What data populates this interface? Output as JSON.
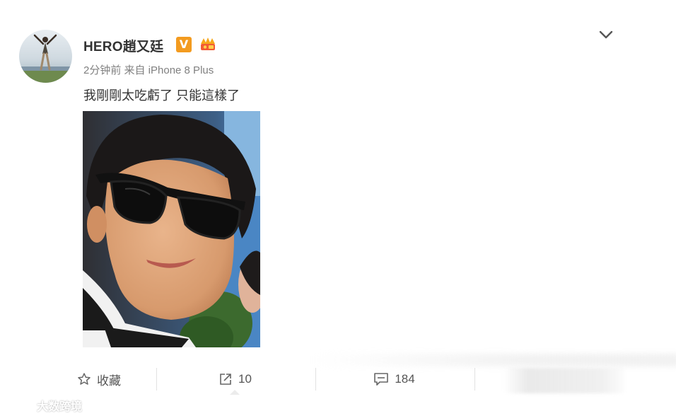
{
  "post": {
    "username": "HERO趙又廷",
    "verified_badge": "V",
    "meta": "2分钟前 来自 iPhone 8 Plus",
    "text": "我剛剛太吃虧了 只能這樣了"
  },
  "actions": {
    "favorite_label": "收藏",
    "repost_count": "10",
    "comment_count": "184"
  },
  "watermark": {
    "text": "大数跨境"
  },
  "colors": {
    "verified": "#f39b1f",
    "text": "#333333",
    "meta": "#808080"
  },
  "icons": [
    "chevron-down-icon",
    "star-icon",
    "repost-icon",
    "comment-icon",
    "member-crown-icon"
  ]
}
